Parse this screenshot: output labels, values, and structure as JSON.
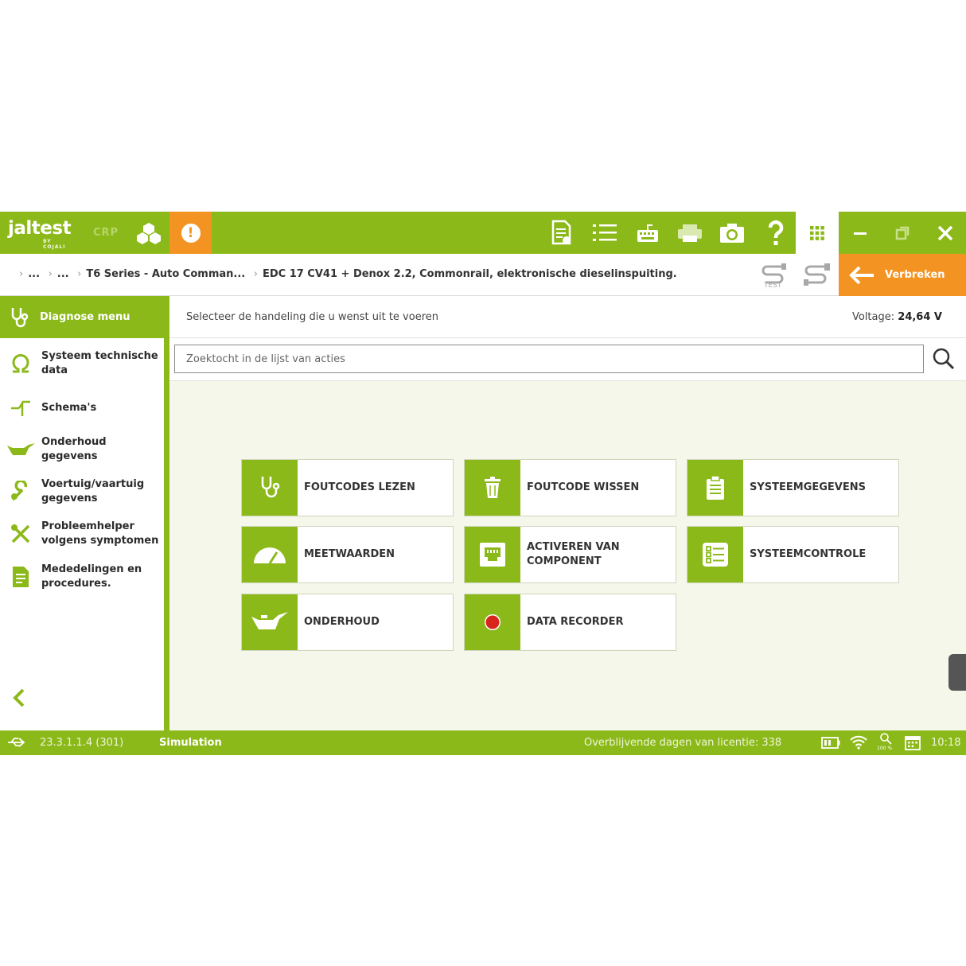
{
  "topbar": {
    "logo": "jaltest",
    "logo_sub": "BY COJALI",
    "crp": "CRP",
    "alert": "!",
    "icons": [
      "report-icon",
      "list-icon",
      "keyboard-icon",
      "printer-icon",
      "camera-icon",
      "help-icon",
      "apps-grid-icon"
    ]
  },
  "breadcrumb": {
    "items": [
      "...",
      "...",
      "T6 Series - Auto Comman...",
      "EDC 17 CV41 + Denox 2.2, Commonrail, elektronische dieselinspuiting."
    ],
    "test_label": "TEST",
    "disconnect": "Verbreken"
  },
  "sidebar": {
    "header": "Diagnose menu",
    "items": [
      {
        "label": "Systeem technische data",
        "icon": "omega-icon"
      },
      {
        "label": "Schema's",
        "icon": "schema-icon"
      },
      {
        "label": "Onderhoud gegevens",
        "icon": "oil-can-icon"
      },
      {
        "label": "Voertuig/vaartuig gegevens",
        "icon": "wrench-icon"
      },
      {
        "label": "Probleemhelper volgens symptomen",
        "icon": "tools-icon"
      },
      {
        "label": "Mededelingen en procedures.",
        "icon": "document-icon"
      }
    ]
  },
  "main": {
    "instruction": "Selecteer de handeling die u wenst uit te voeren",
    "voltage_label": "Voltage:",
    "voltage_value": "24,64 V",
    "search_placeholder": "Zoektocht in de lijst van acties",
    "actions": [
      {
        "label": "FOUTCODES LEZEN",
        "icon": "stethoscope-icon"
      },
      {
        "label": "FOUTCODE WISSEN",
        "icon": "trash-icon"
      },
      {
        "label": "SYSTEEMGEGEVENS",
        "icon": "clipboard-icon"
      },
      {
        "label": "MEETWAARDEN",
        "icon": "gauge-icon"
      },
      {
        "label": "ACTIVEREN VAN COMPONENT",
        "icon": "component-icon"
      },
      {
        "label": "SYSTEEMCONTROLE",
        "icon": "checklist-icon"
      },
      {
        "label": "ONDERHOUD",
        "icon": "oil-can-icon"
      },
      {
        "label": "DATA RECORDER",
        "icon": "record-icon"
      }
    ]
  },
  "statusbar": {
    "version": "23.3.1.1.4 (301)",
    "mode": "Simulation",
    "license_label": "Overblijvende dagen van licentie: 338",
    "zoom": "100 %",
    "time": "10:18"
  },
  "colors": {
    "brand_green": "#8cb91a",
    "accent_orange": "#f39322",
    "record_red": "#d8251c"
  }
}
